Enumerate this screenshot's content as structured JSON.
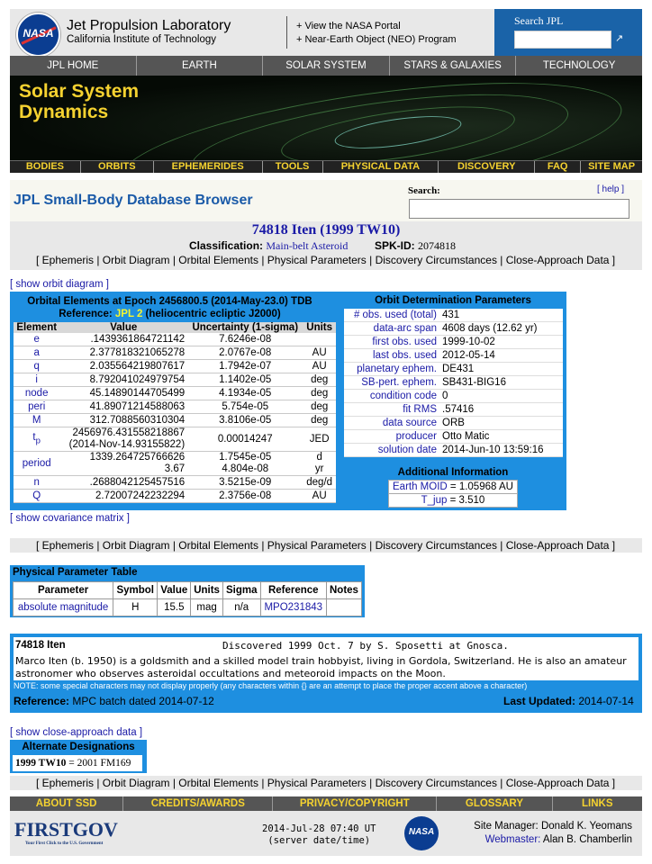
{
  "header": {
    "org_title": "Jet Propulsion Laboratory",
    "org_sub": "California Institute of Technology",
    "link1": "+ View the NASA Portal",
    "link2": "+ Near-Earth Object (NEO) Program",
    "search_label": "Search JPL",
    "search_go": "↗",
    "nasa_logo_text": "NASA"
  },
  "topnav": [
    "JPL HOME",
    "EARTH",
    "SOLAR SYSTEM",
    "STARS & GALAXIES",
    "TECHNOLOGY"
  ],
  "banner": {
    "line1": "Solar System",
    "line2": "Dynamics"
  },
  "botnav": [
    "BODIES",
    "ORBITS",
    "EPHEMERIDES",
    "TOOLS",
    "PHYSICAL DATA",
    "DISCOVERY",
    "FAQ",
    "SITE MAP"
  ],
  "page": {
    "title": "JPL Small-Body Database Browser",
    "search_label": "Search:",
    "help": "[ help ]"
  },
  "object": {
    "name": "74818 Iten (1999 TW10)",
    "class_label": "Classification:",
    "class_value": "Main-belt Asteroid",
    "spk_label": "SPK-ID:",
    "spk_value": "2074818"
  },
  "tabs_text": "[ Ephemeris | Orbit Diagram | Orbital Elements | Physical Parameters | Discovery Circumstances | Close-Approach Data ]",
  "show_orbit": "[ show orbit diagram ]",
  "orbital": {
    "heading1": "Orbital Elements at Epoch 2456800.5 (2014-May-23.0) TDB",
    "heading2a": "Reference: ",
    "heading2b": "JPL 2",
    "heading2c": " (heliocentric ecliptic J2000)",
    "columns": [
      "Element",
      "Value",
      "Uncertainty (1-sigma)",
      "Units"
    ],
    "rows": [
      {
        "el": "e",
        "val": ".1439361864721142",
        "unc": "7.6246e-08",
        "unit": ""
      },
      {
        "el": "a",
        "val": "2.377818321065278",
        "unc": "2.0767e-08",
        "unit": "AU"
      },
      {
        "el": "q",
        "val": "2.035564219807617",
        "unc": "1.7942e-07",
        "unit": "AU"
      },
      {
        "el": "i",
        "val": "8.792041024979754",
        "unc": "1.1402e-05",
        "unit": "deg"
      },
      {
        "el": "node",
        "val": "45.14890144705499",
        "unc": "4.1934e-05",
        "unit": "deg"
      },
      {
        "el": "peri",
        "val": "41.89071214588063",
        "unc": "5.754e-05",
        "unit": "deg"
      },
      {
        "el": "M",
        "val": "312.7088560310304",
        "unc": "3.8106e-05",
        "unit": "deg"
      }
    ],
    "tp": {
      "el": "t",
      "sub": "p",
      "val1": "2456976.431558218867",
      "val2": "(2014-Nov-14.93155822)",
      "unc": "0.00014247",
      "unit": "JED"
    },
    "period": {
      "el": "period",
      "val1": "1339.264725766626",
      "val2": "3.67",
      "unc1": "1.7545e-05",
      "unc2": "4.804e-08",
      "unit1": "d",
      "unit2": "yr"
    },
    "rows2": [
      {
        "el": "n",
        "val": ".2688042125457516",
        "unc": "3.5215e-09",
        "unit": "deg/d"
      },
      {
        "el": "Q",
        "val": "2.72007242232294",
        "unc": "2.3756e-08",
        "unit": "AU"
      }
    ]
  },
  "od": {
    "heading": "Orbit Determination Parameters",
    "rows": [
      {
        "k": "# obs. used (total)",
        "v": "431"
      },
      {
        "k": "data-arc span",
        "v": "4608 days (12.62 yr)"
      },
      {
        "k": "first obs. used",
        "v": "1999-10-02"
      },
      {
        "k": "last obs. used",
        "v": "2012-05-14"
      },
      {
        "k": "planetary ephem.",
        "v": "DE431"
      },
      {
        "k": "SB-pert. ephem.",
        "v": "SB431-BIG16"
      },
      {
        "k": "condition code",
        "v": "0"
      },
      {
        "k": "fit RMS",
        "v": ".57416"
      },
      {
        "k": "data source",
        "v": "ORB"
      },
      {
        "k": "producer",
        "v": "Otto Matic"
      },
      {
        "k": "solution date",
        "v": "2014-Jun-10 13:59:16"
      }
    ]
  },
  "additional": {
    "heading": "Additional Information",
    "moid_k": "Earth MOID",
    "moid_v": " = 1.05968 AU",
    "tjup_k": "T_jup",
    "tjup_v": " = 3.510"
  },
  "show_cov": "[ show covariance matrix ]",
  "physical": {
    "title": "Physical Parameter Table",
    "columns": [
      "Parameter",
      "Symbol",
      "Value",
      "Units",
      "Sigma",
      "Reference",
      "Notes"
    ],
    "row": {
      "param": "absolute magnitude",
      "symbol": "H",
      "value": "15.5",
      "units": "mag",
      "sigma": "n/a",
      "ref": "MPO231843",
      "notes": ""
    }
  },
  "description": {
    "name": "74818 Iten",
    "discovered": "Discovered 1999 Oct. 7 by S. Sposetti at Gnosca.",
    "text": "Marco Iten (b. 1950) is a goldsmith and a skilled model train hobbyist, living in Gordola, Switzerland. He is also an amateur astronomer who observes asteroidal occultations and meteoroid impacts on the Moon.",
    "note": "NOTE: some special characters may not display properly (any characters within {} are an attempt to place the proper accent above a character)",
    "ref_label": "Reference:",
    "ref_value": "MPC batch dated 2014-07-12",
    "upd_label": "Last Updated:",
    "upd_value": "2014-07-14"
  },
  "show_ca": "[ show close-approach data ]",
  "alternate": {
    "title": "Alternate Designations",
    "primary": "1999 TW10",
    "rest": " = 2001 FM169"
  },
  "footer": {
    "links": [
      "ABOUT SSD",
      "CREDITS/AWARDS",
      "PRIVACY/COPYRIGHT",
      "GLOSSARY",
      "LINKS"
    ],
    "firstgov": "FIRSTGOV",
    "firstgov_tag": "Your First Click to the U.S. Government",
    "time1": "2014-Jul-28 07:40 UT",
    "time2": "(server date/time)",
    "nasa_logo_text": "NASA",
    "mgr_label": "Site Manager:",
    "mgr_name": "Donald K. Yeomans",
    "web_label": "Webmaster:",
    "web_name": "Alan B. Chamberlin"
  },
  "colors": {
    "panel_blue": "#1e8fe0",
    "link_blue": "#1a1aa6",
    "nav_gold": "#f5d230",
    "title_blue": "#1a5aa8"
  }
}
